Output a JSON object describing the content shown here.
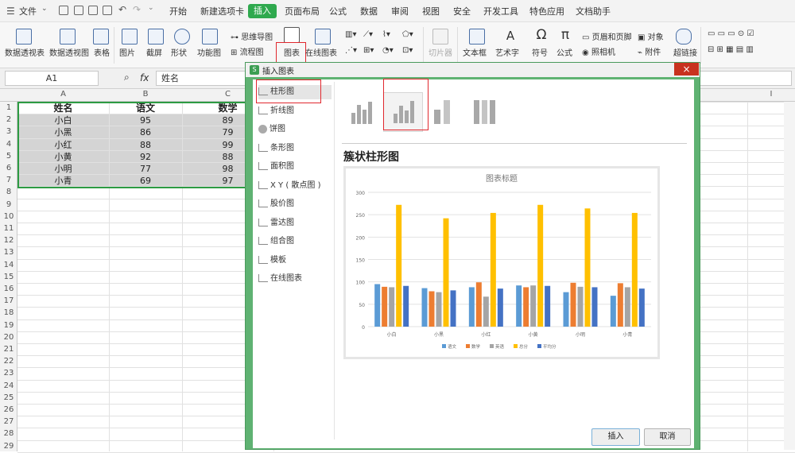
{
  "menubar": {
    "file_label": "文件",
    "tabs": [
      "开始",
      "新建选项卡",
      "插入",
      "页面布局",
      "公式",
      "数据",
      "审阅",
      "视图",
      "安全",
      "开发工具",
      "特色应用",
      "文档助手"
    ],
    "active_tab": "插入"
  },
  "toolbar": {
    "pivot_table": "数据透视表",
    "pivot_chart": "数据透视图",
    "table": "表格",
    "picture": "图片",
    "screenshot": "截屏",
    "shapes": "形状",
    "function_chart": "功能图",
    "mindmap": "思维导图",
    "flowchart": "流程图",
    "chart": "图表",
    "online_chart": "在线图表",
    "slicer": "切片器",
    "textbox": "文本框",
    "art_text": "艺术字",
    "symbol": "符号",
    "formula": "公式",
    "header_footer": "页眉和页脚",
    "object": "对象",
    "camera": "照相机",
    "attachment": "附件",
    "hyperlink": "超链接"
  },
  "formulabar": {
    "cell_ref": "A1",
    "fx": "fx",
    "content": "姓名"
  },
  "sheet": {
    "columns": [
      "A",
      "B",
      "C",
      "I"
    ],
    "rows": [
      "1",
      "2",
      "3",
      "4",
      "5",
      "6",
      "7",
      "8",
      "9",
      "10",
      "11",
      "12",
      "13",
      "14",
      "15",
      "16",
      "17",
      "18",
      "19",
      "20",
      "21",
      "22",
      "23",
      "24",
      "25",
      "26",
      "27",
      "28",
      "29"
    ],
    "headers": [
      "姓名",
      "语文",
      "数学"
    ],
    "data": [
      [
        "小白",
        "95",
        "89"
      ],
      [
        "小黑",
        "86",
        "79"
      ],
      [
        "小红",
        "88",
        "99"
      ],
      [
        "小黄",
        "92",
        "88"
      ],
      [
        "小明",
        "77",
        "98"
      ],
      [
        "小青",
        "69",
        "97"
      ]
    ]
  },
  "dialog": {
    "title": "插入图表",
    "close": "×",
    "chart_types": [
      "柱形图",
      "折线图",
      "饼图",
      "条形图",
      "面积图",
      "X Y ( 散点图 )",
      "股价图",
      "雷达图",
      "组合图",
      "模板",
      "在线图表"
    ],
    "selected_type": "柱形图",
    "subtype_title": "簇状柱形图",
    "insert_button": "插入",
    "cancel_button": "取消"
  },
  "chart_data": {
    "type": "bar",
    "title": "图表标题",
    "categories": [
      "小白",
      "小黑",
      "小红",
      "小黄",
      "小明",
      "小青"
    ],
    "ylim": [
      0,
      300
    ],
    "yticks": [
      "0",
      "50",
      "100",
      "150",
      "200",
      "250",
      "300"
    ],
    "grid": true,
    "legend_position": "bottom",
    "series": [
      {
        "name": "语文",
        "color": "#5b9bd5",
        "values": [
          95,
          86,
          88,
          92,
          77,
          69
        ]
      },
      {
        "name": "数学",
        "color": "#ed7d31",
        "values": [
          89,
          79,
          99,
          88,
          98,
          97
        ]
      },
      {
        "name": "英语",
        "color": "#a5a5a5",
        "values": [
          88,
          77,
          67,
          92,
          89,
          88
        ]
      },
      {
        "name": "总分",
        "color": "#ffc000",
        "values": [
          272,
          242,
          254,
          272,
          264,
          254
        ]
      },
      {
        "name": "平均分",
        "color": "#4472c4",
        "values": [
          91,
          81,
          85,
          91,
          88,
          85
        ]
      }
    ]
  },
  "colors": {
    "accent_green": "#2fa94e",
    "highlight_red": "#e0282e",
    "dialog_frame": "#5fb272"
  }
}
